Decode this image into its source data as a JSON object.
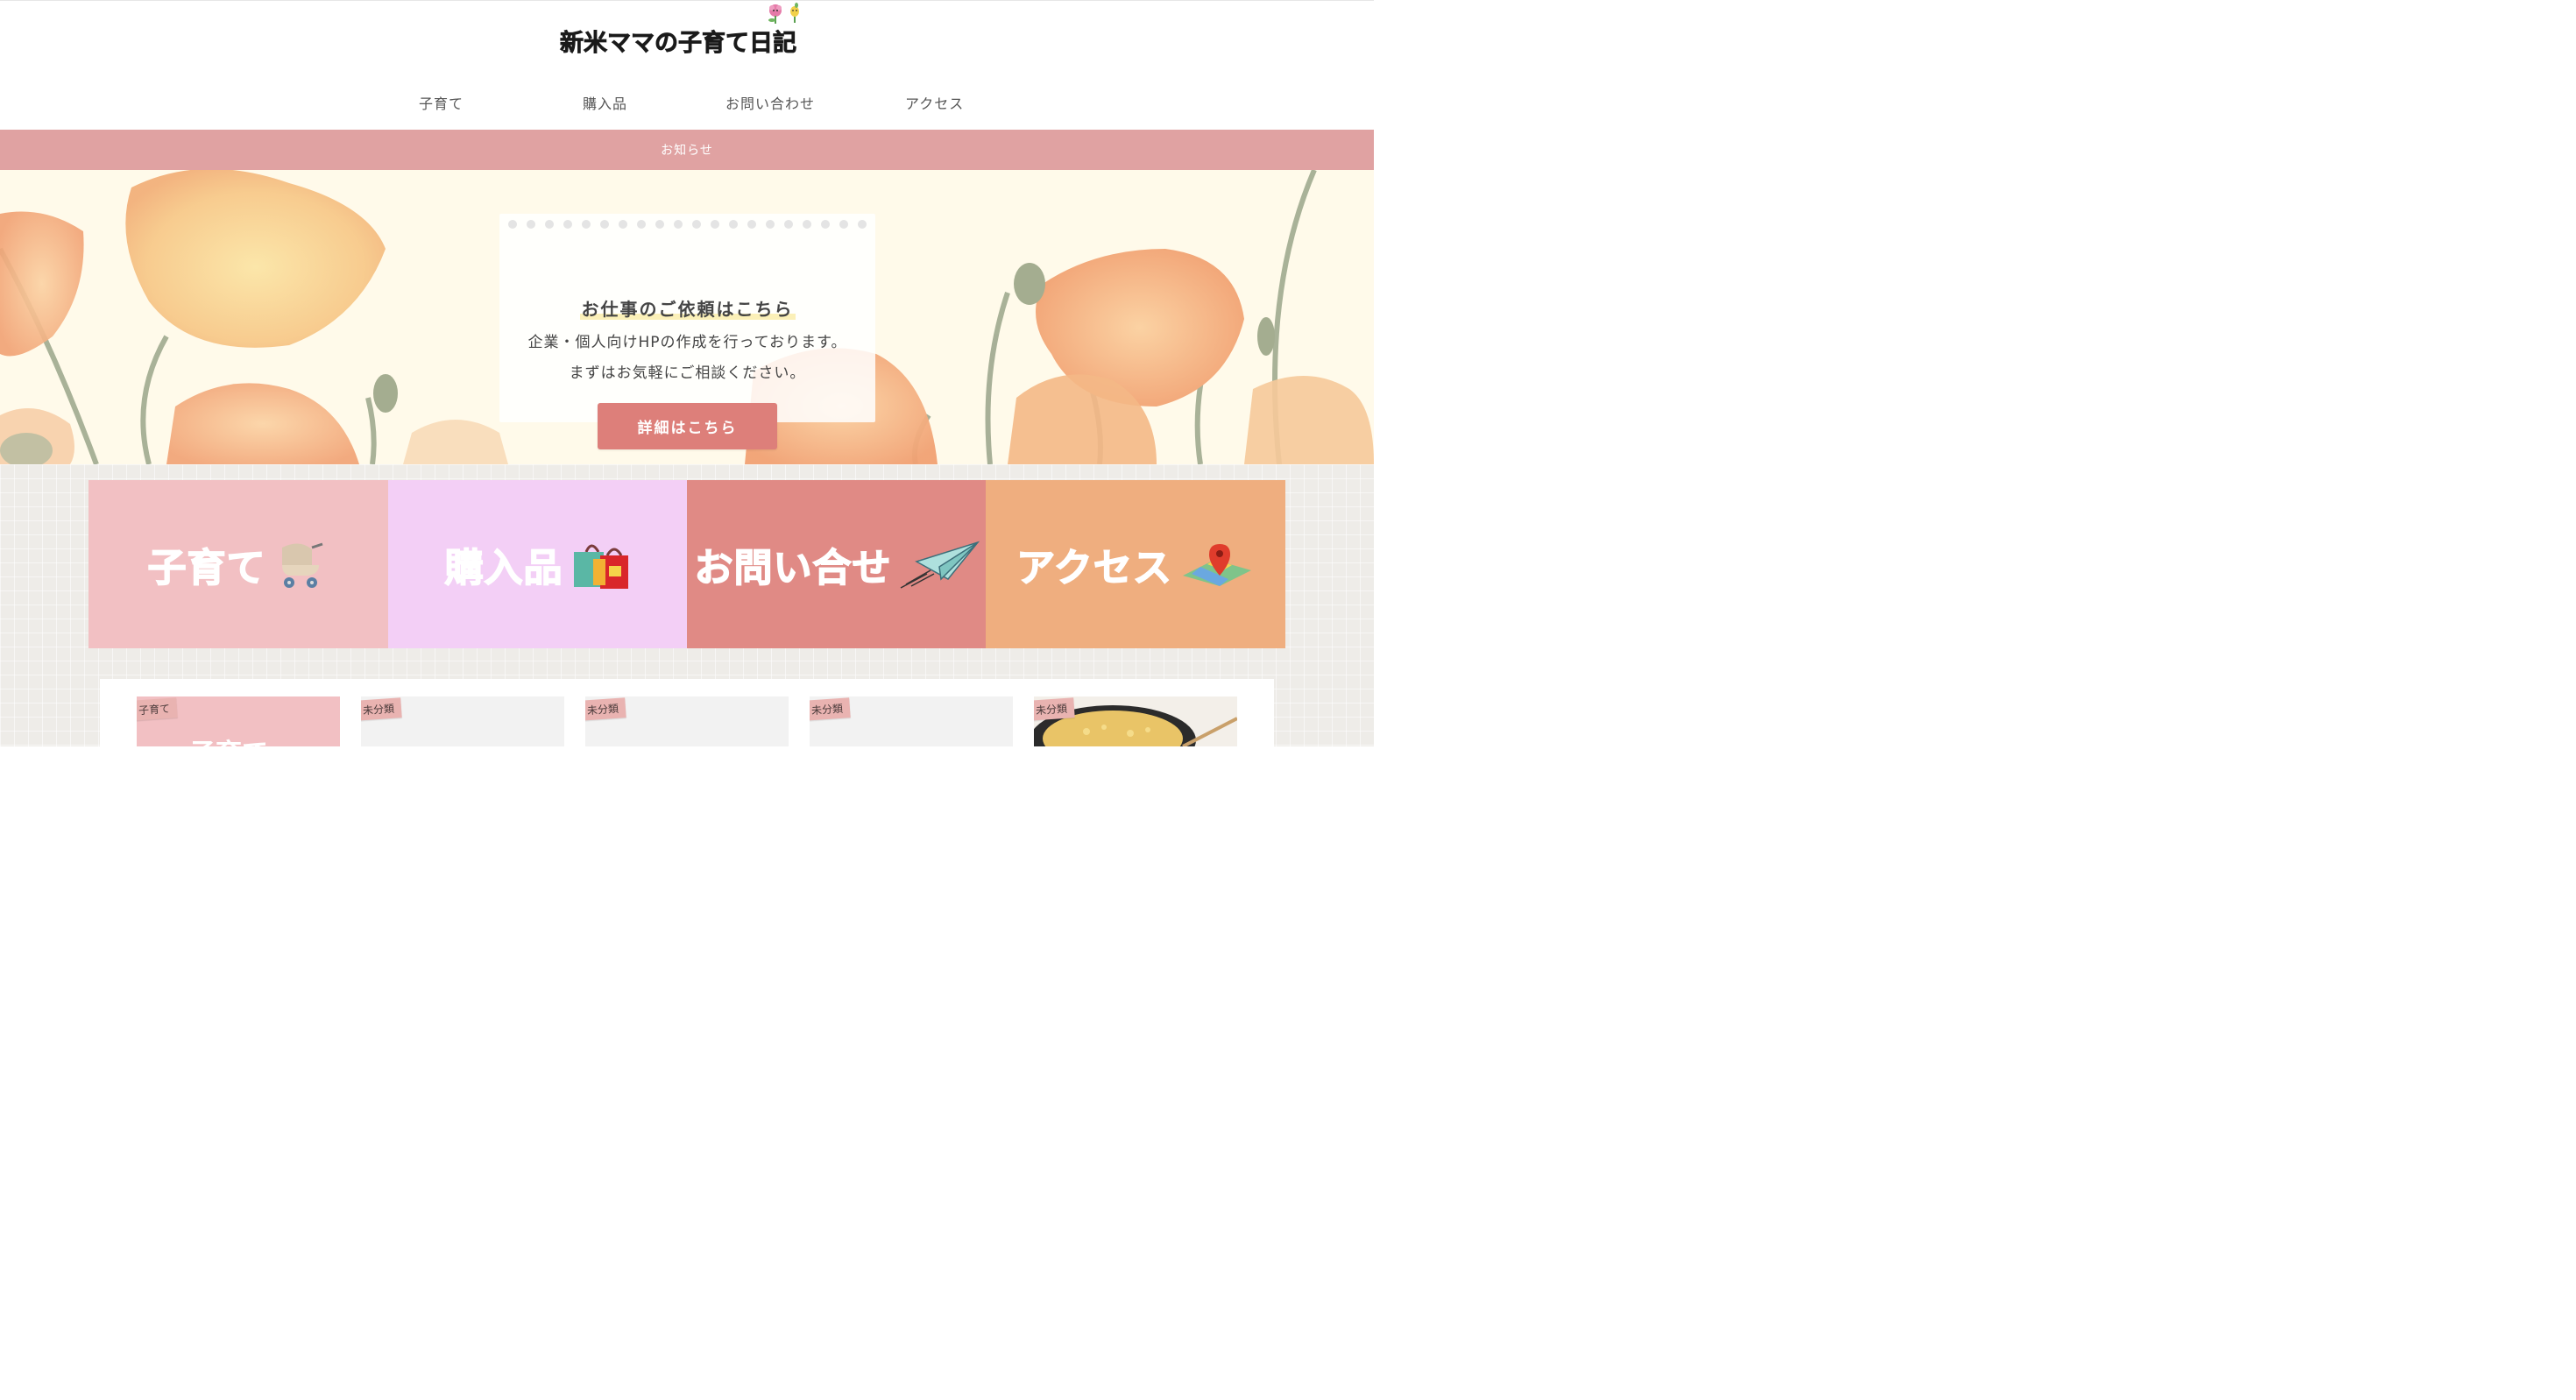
{
  "site": {
    "logo_text": "新米ママの子育て日記"
  },
  "nav": {
    "items": [
      "子育て",
      "購入品",
      "お問い合わせ",
      "アクセス"
    ]
  },
  "notice": {
    "label": "お知らせ"
  },
  "hero": {
    "title": "お仕事のご依頼はこちら",
    "line1": "企業・個人向けHPの作成を行っております。",
    "line2": "まずはお気軽にご相談ください。",
    "button_label": "詳細はこちら"
  },
  "banners": [
    {
      "label": "子育て",
      "icon": "baby-stroller-icon",
      "color": "#f2c0c3"
    },
    {
      "label": "購入品",
      "icon": "shopping-bags-icon",
      "color": "#f3cff6"
    },
    {
      "label": "お問い合せ",
      "icon": "paper-plane-icon",
      "color": "#e08a85"
    },
    {
      "label": "アクセス",
      "icon": "map-pin-icon",
      "color": "#efae7f"
    }
  ],
  "posts": [
    {
      "tag": "子育て"
    },
    {
      "tag": "未分類"
    },
    {
      "tag": "未分類"
    },
    {
      "tag": "未分類"
    },
    {
      "tag": "未分類"
    }
  ],
  "colors": {
    "notice_bar": "#e0a2a2",
    "cta_button": "#dd7f7a",
    "tag": "#e9b3b1"
  }
}
